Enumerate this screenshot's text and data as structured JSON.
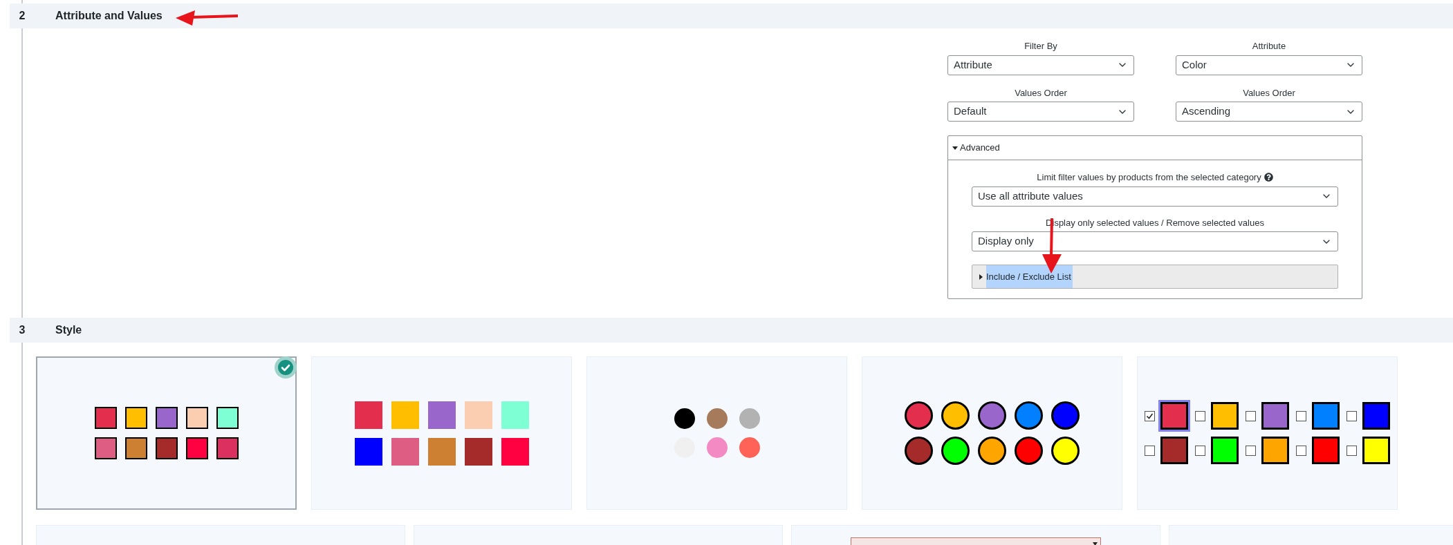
{
  "sections": [
    {
      "number": "2",
      "title": "Attribute and Values"
    },
    {
      "number": "3",
      "title": "Style"
    }
  ],
  "filters": [
    {
      "label": "Filter By",
      "value": "Attribute"
    },
    {
      "label": "Attribute",
      "value": "Color"
    },
    {
      "label": "Values Order",
      "value": "Default"
    },
    {
      "label": "Values Order",
      "value": "Ascending"
    }
  ],
  "advanced": {
    "title": "Advanced",
    "expanded": true,
    "limit": {
      "label": "Limit filter values by products from the selected category",
      "value": "Use all attribute values"
    },
    "display": {
      "label": "Display only selected values / Remove selected values",
      "value": "Display only"
    },
    "include_exclude": {
      "title": "Include / Exclude List",
      "expanded": false
    }
  },
  "styles": [
    {
      "kind": "bordered-squares",
      "selected": true,
      "swatches": [
        {
          "color": "#e32e4d"
        },
        {
          "color": "#ffbf00"
        },
        {
          "color": "#9966cc"
        },
        {
          "color": "#fbceb1"
        },
        {
          "color": "#7fffd4"
        },
        {
          "color": "#de5d83"
        },
        {
          "color": "#cd7f32"
        },
        {
          "color": "#a52a2a"
        },
        {
          "color": "#ff0040"
        },
        {
          "color": "#dc3060"
        }
      ]
    },
    {
      "kind": "squares",
      "selected": false,
      "swatches": [
        {
          "color": "#e32e4d"
        },
        {
          "color": "#ffbf00"
        },
        {
          "color": "#9966cc"
        },
        {
          "color": "#fbceb1"
        },
        {
          "color": "#7fffd4"
        },
        {
          "color": "#0000ff"
        },
        {
          "color": "#de5d83"
        },
        {
          "color": "#cd7f32"
        },
        {
          "color": "#a52a2a"
        },
        {
          "color": "#ff0040"
        }
      ]
    },
    {
      "kind": "dots",
      "selected": false,
      "swatches": [
        {
          "color": "#000000"
        },
        {
          "color": "#a67b5b"
        },
        {
          "color": "#b2b2b2"
        },
        {
          "color": "#f0f0f0"
        },
        {
          "color": "#f38ac4"
        },
        {
          "color": "#ff6257"
        }
      ]
    },
    {
      "kind": "circles",
      "selected": false,
      "swatches": [
        {
          "color": "#e32e4d"
        },
        {
          "color": "#ffbf00"
        },
        {
          "color": "#9966cc"
        },
        {
          "color": "#0080ff"
        },
        {
          "color": "#0000ff"
        },
        {
          "color": "#a52a2a"
        },
        {
          "color": "#00ff00"
        },
        {
          "color": "#ffa500"
        },
        {
          "color": "#ff0000"
        },
        {
          "color": "#ffff00"
        }
      ]
    },
    {
      "kind": "checkbox-squares",
      "selected": false,
      "swatches": [
        {
          "color": "#e32e4d",
          "checked": true
        },
        {
          "color": "#ffbf00",
          "checked": false
        },
        {
          "color": "#9966cc",
          "checked": false
        },
        {
          "color": "#0080ff",
          "checked": false
        },
        {
          "color": "#0000ff",
          "checked": false
        },
        {
          "color": "#a52a2a",
          "checked": false
        },
        {
          "color": "#00ff00",
          "checked": false
        },
        {
          "color": "#ffa500",
          "checked": false
        },
        {
          "color": "#ff0000",
          "checked": false
        },
        {
          "color": "#ffff00",
          "checked": false
        }
      ]
    }
  ],
  "more_styles": [
    {
      "kind": "blank"
    },
    {
      "kind": "blank"
    },
    {
      "kind": "select"
    },
    {
      "kind": "blank"
    }
  ]
}
